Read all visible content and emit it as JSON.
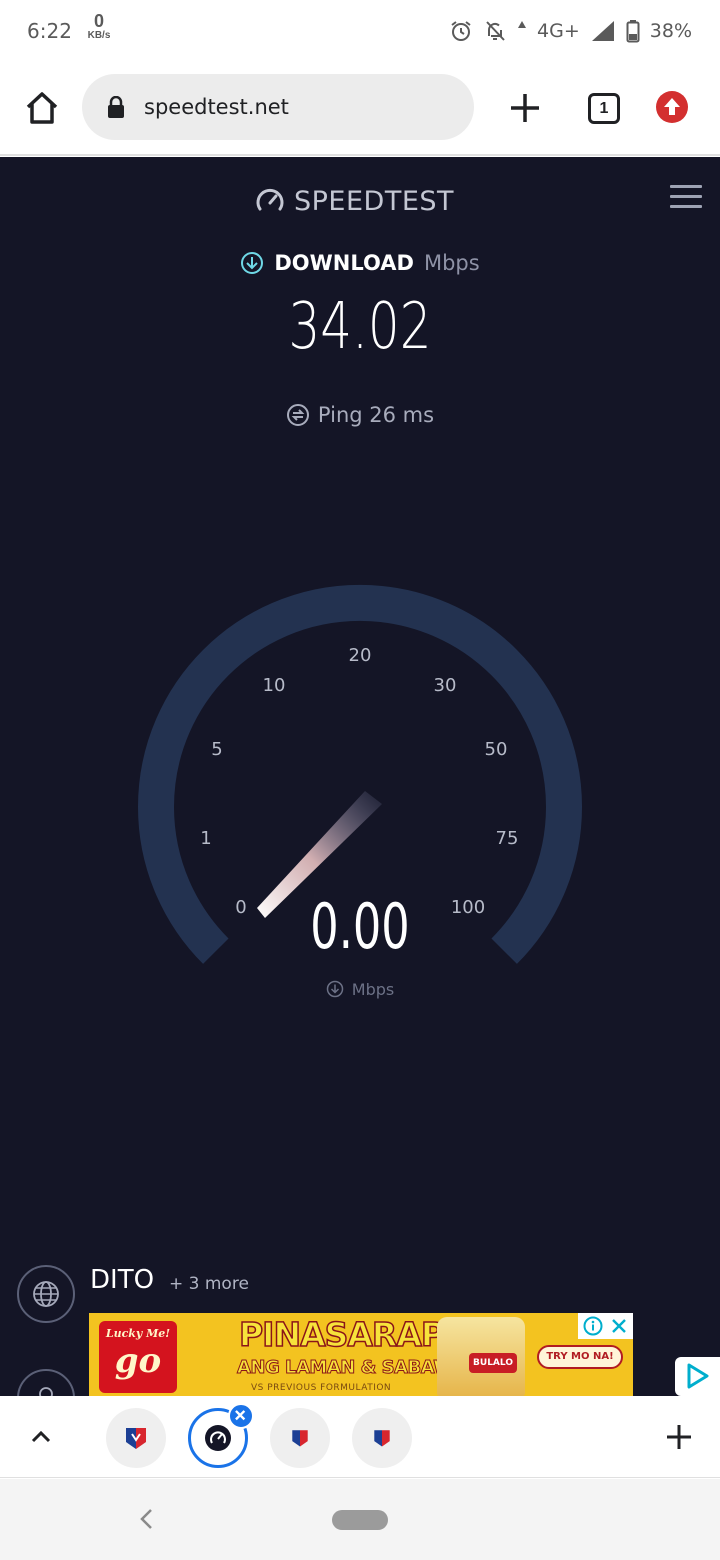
{
  "status_bar": {
    "time": "6:22",
    "data_rate_value": "0",
    "data_rate_unit": "KB/s",
    "network": "4G+",
    "battery": "38%"
  },
  "browser": {
    "url": "speedtest.net",
    "tab_count": "1"
  },
  "speedtest": {
    "logo_text": "SPEEDTEST",
    "download_label": "DOWNLOAD",
    "download_unit": "Mbps",
    "download_value": "34.02",
    "ping_text": "Ping 26 ms",
    "gauge": {
      "ticks": [
        "0",
        "1",
        "5",
        "10",
        "20",
        "30",
        "50",
        "75",
        "100"
      ],
      "current_value": "0.00",
      "unit": "Mbps"
    },
    "isp": {
      "name": "DITO",
      "more": "+ 3 more"
    }
  },
  "ad": {
    "brand_top": "Lucky Me!",
    "brand_main": "go",
    "headline": "PINASARAP",
    "subline": "ANG LAMAN & SABAW!",
    "fine_print": "VS PREVIOUS FORMULATION",
    "cup_label": "BULALO",
    "cta": "TRY MO NA!"
  },
  "colors": {
    "page_bg": "#141526",
    "gauge_track": "#233250",
    "accent_cyan": "#6fd8e6",
    "tab_active": "#1a73e8",
    "update_red": "#d32f2f"
  }
}
